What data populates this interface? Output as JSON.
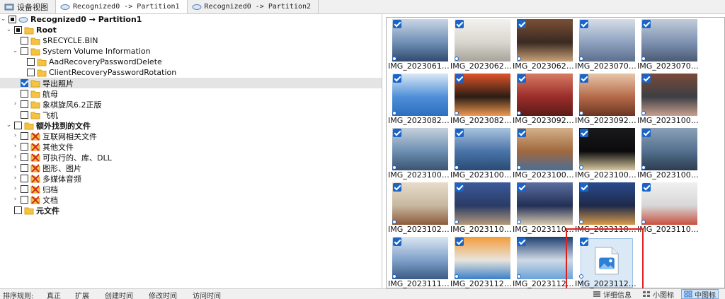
{
  "tabs": [
    {
      "label": "设备视图"
    },
    {
      "label": "Recognized0 -> Partition1"
    },
    {
      "label": "Recognized0 -> Partition2"
    }
  ],
  "tree": {
    "nodes": [
      {
        "label": "Recognized0 → Partition1"
      },
      {
        "label": "Root"
      },
      {
        "label": "$RECYCLE.BIN"
      },
      {
        "label": "System Volume Information"
      },
      {
        "label": "AadRecoveryPasswordDelete"
      },
      {
        "label": "ClientRecoveryPasswordRotation"
      },
      {
        "label": "导出照片"
      },
      {
        "label": "航母"
      },
      {
        "label": "象棋旋风6.2正版"
      },
      {
        "label": "飞机"
      },
      {
        "label": "额外找到的文件"
      },
      {
        "label": "互联网相关文件"
      },
      {
        "label": "其他文件"
      },
      {
        "label": "可执行的、库、DLL"
      },
      {
        "label": "图形、图片"
      },
      {
        "label": "多媒体音频"
      },
      {
        "label": "归档"
      },
      {
        "label": "文档"
      },
      {
        "label": "元文件"
      }
    ]
  },
  "grid": {
    "items": [
      {
        "label": "IMG_2023061…",
        "checked": true
      },
      {
        "label": "IMG_2023062…",
        "checked": true
      },
      {
        "label": "IMG_2023062…",
        "checked": true
      },
      {
        "label": "IMG_2023070…",
        "checked": true
      },
      {
        "label": "IMG_2023070…",
        "checked": true
      },
      {
        "label": "IMG_2023082…",
        "checked": true
      },
      {
        "label": "IMG_2023082…",
        "checked": true
      },
      {
        "label": "IMG_2023092…",
        "checked": true
      },
      {
        "label": "IMG_2023092…",
        "checked": true
      },
      {
        "label": "IMG_2023100…",
        "checked": true
      },
      {
        "label": "IMG_2023100…",
        "checked": true
      },
      {
        "label": "IMG_2023100…",
        "checked": true
      },
      {
        "label": "IMG_2023100…",
        "checked": true
      },
      {
        "label": "IMG_2023100…",
        "checked": true
      },
      {
        "label": "IMG_2023100…",
        "checked": true
      },
      {
        "label": "IMG_2023102…",
        "checked": true
      },
      {
        "label": "IMG_2023110…",
        "checked": true
      },
      {
        "label": "IMG_2023110…",
        "checked": true
      },
      {
        "label": "IMG_2023110…",
        "checked": true
      },
      {
        "label": "IMG_2023110…",
        "checked": true
      },
      {
        "label": "IMG_2023111…",
        "checked": true
      },
      {
        "label": "IMG_2023112…",
        "checked": true
      },
      {
        "label": "IMG_2023112…",
        "checked": true
      },
      {
        "label": "IMG_2023112…",
        "checked": true
      }
    ]
  },
  "status": {
    "sort_label": "排序规则:",
    "sort_options": [
      "真正",
      "扩展",
      "创建时间",
      "修改时间",
      "访问时间"
    ],
    "view_modes": [
      {
        "label": "详细信息",
        "active": false
      },
      {
        "label": "小图标",
        "active": false
      },
      {
        "label": "中图标",
        "active": true
      }
    ]
  },
  "colors": {
    "accent": "#1a64c8",
    "highlight": "#e02020",
    "folder": "#f5c242"
  }
}
